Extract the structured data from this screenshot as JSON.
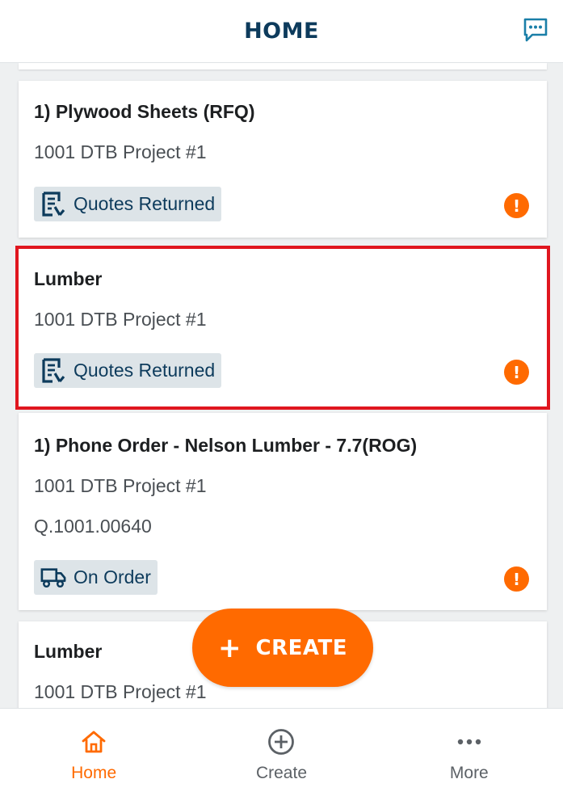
{
  "header": {
    "title": "HOME",
    "chat_icon": "chat-bubble-icon"
  },
  "colors": {
    "accent": "#ff6a00",
    "navy": "#0d3b5c",
    "badge_bg": "#dde4e8",
    "highlight": "#e0161f"
  },
  "cards": [
    {
      "title": "1) Plywood Sheets (RFQ)",
      "project": "1001 DTB Project #1",
      "status": "Quotes Returned",
      "status_icon": "quote-document-icon",
      "alert": "!"
    },
    {
      "title": "Lumber",
      "project": "1001 DTB Project #1",
      "status": "Quotes Returned",
      "status_icon": "quote-document-icon",
      "alert": "!"
    },
    {
      "title": "1) Phone Order - Nelson Lumber - 7.7(ROG)",
      "project": "1001 DTB Project #1",
      "reference": "Q.1001.00640",
      "status": "On Order",
      "status_icon": "truck-icon",
      "alert": "!"
    },
    {
      "title": "Lumber",
      "project": "1001 DTB Project #1"
    }
  ],
  "fab": {
    "plus": "+",
    "label": "CREATE"
  },
  "bottom_nav": [
    {
      "label": "Home",
      "icon": "home-icon",
      "active": true
    },
    {
      "label": "Create",
      "icon": "plus-circle-icon",
      "active": false
    },
    {
      "label": "More",
      "icon": "more-dots-icon",
      "active": false
    }
  ]
}
